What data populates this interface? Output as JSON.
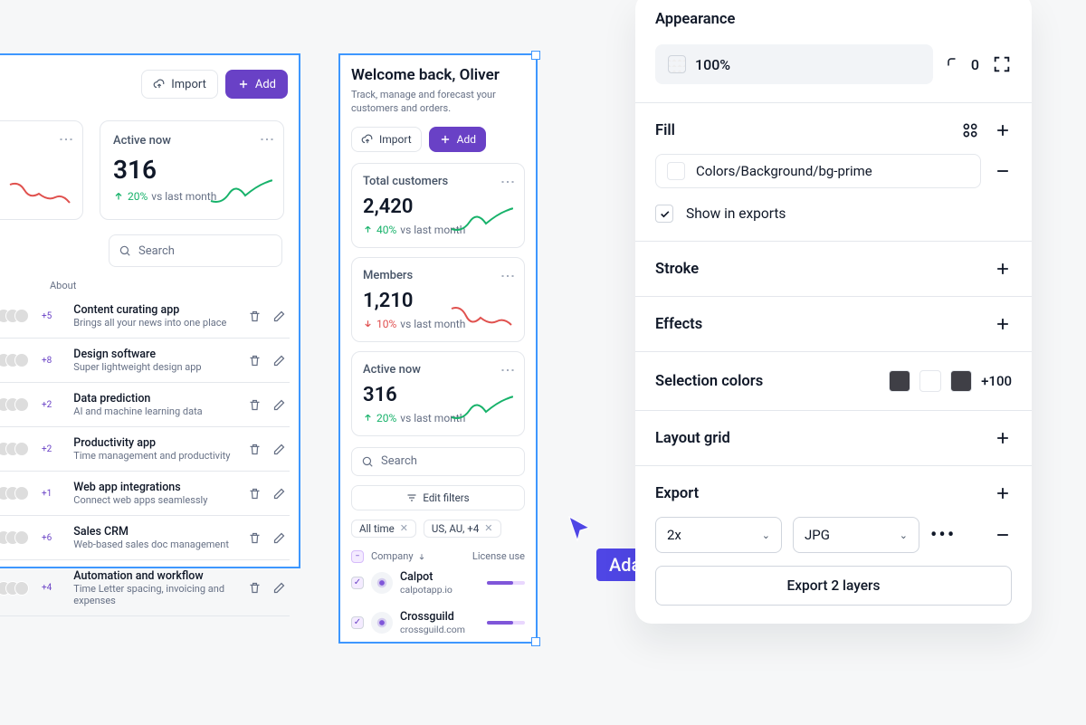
{
  "cursor_user": "Adam",
  "frameA": {
    "toolbar": {
      "import": "Import",
      "add": "Add"
    },
    "card_active": {
      "title": "Active now",
      "value": "316",
      "delta_pct": "20%",
      "delta_note": "vs last month",
      "direction": "up"
    },
    "search_placeholder": "Search",
    "about_header": "About",
    "rows": [
      {
        "plus": "+5",
        "title": "Content curating app",
        "sub": "Brings all your news into one place"
      },
      {
        "plus": "+8",
        "title": "Design software",
        "sub": "Super lightweight design app"
      },
      {
        "plus": "+2",
        "title": "Data prediction",
        "sub": "AI and machine learning data"
      },
      {
        "plus": "+2",
        "title": "Productivity app",
        "sub": "Time management and productivity"
      },
      {
        "plus": "+1",
        "title": "Web app integrations",
        "sub": "Connect web apps seamlessly"
      },
      {
        "plus": "+6",
        "title": "Sales CRM",
        "sub": "Web-based sales doc management"
      },
      {
        "plus": "+4",
        "title": "Automation and workflow",
        "sub": "Time Letter spacing, invoicing and expenses"
      }
    ]
  },
  "frameB": {
    "welcome_title": "Welcome back, Oliver",
    "welcome_sub": "Track, manage and forecast your customers and orders.",
    "toolbar": {
      "import": "Import",
      "add": "Add"
    },
    "cards": [
      {
        "title": "Total customers",
        "value": "2,420",
        "delta_pct": "40%",
        "delta_note": "vs last month",
        "direction": "up",
        "spark": "green"
      },
      {
        "title": "Members",
        "value": "1,210",
        "delta_pct": "10%",
        "delta_note": "vs last month",
        "direction": "dn",
        "spark": "red"
      },
      {
        "title": "Active now",
        "value": "316",
        "delta_pct": "20%",
        "delta_note": "vs last month",
        "direction": "up",
        "spark": "green"
      }
    ],
    "search_placeholder": "Search",
    "edit_filters": "Edit filters",
    "chips": [
      "All time",
      "US, AU, +4"
    ],
    "table_head": {
      "company": "Company",
      "license": "License use"
    },
    "companies": [
      {
        "name": "Calpot",
        "url": "calpotapp.io"
      },
      {
        "name": "Crossguild",
        "url": "crossguild.com"
      }
    ]
  },
  "panel": {
    "appearance": {
      "title": "Appearance",
      "opacity": "100%",
      "radius": "0"
    },
    "fill": {
      "title": "Fill",
      "color_label": "Colors/Background/bg-prime",
      "show_exports": "Show in exports"
    },
    "stroke": {
      "title": "Stroke"
    },
    "effects": {
      "title": "Effects"
    },
    "selection_colors": {
      "title": "Selection colors",
      "more": "+100",
      "swatches": [
        "#3f3f46",
        "#ffffff",
        "#3f3f46"
      ]
    },
    "layout_grid": {
      "title": "Layout grid"
    },
    "export": {
      "title": "Export",
      "scale": "2x",
      "format": "JPG",
      "button": "Export 2 layers"
    }
  }
}
